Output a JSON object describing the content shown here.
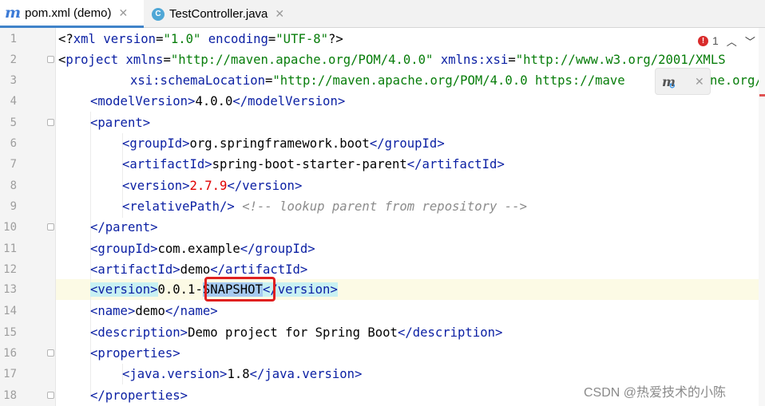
{
  "tabs": [
    {
      "label": "pom.xml (demo)",
      "icon": "maven-icon",
      "active": true
    },
    {
      "label": "TestController.java",
      "icon": "class-c-icon",
      "active": false
    }
  ],
  "inspections": {
    "error_count": "1"
  },
  "line_numbers": [
    "1",
    "2",
    "3",
    "4",
    "5",
    "6",
    "7",
    "8",
    "9",
    "10",
    "11",
    "12",
    "13",
    "14",
    "15",
    "16",
    "17",
    "18"
  ],
  "code": {
    "l1": {
      "a": "<?",
      "b": "xml",
      "c": " ",
      "d": "version",
      "e": "=",
      "f": "\"1.0\"",
      "g": " ",
      "h": "encoding",
      "i": "=",
      "j": "\"UTF-8\"",
      "k": "?>"
    },
    "l2": {
      "a": "<",
      "b": "project",
      "c": " ",
      "d": "xmlns",
      "e": "=",
      "f": "\"http://maven.apache.org/POM/4.0.0\"",
      "g": " ",
      "h": "xmlns:xsi",
      "i": "=",
      "j": "\"http://www.w3.org/2001/XMLS"
    },
    "l3": {
      "a": "xsi:schemaLocation",
      "b": "=",
      "c": "\"http://maven.apache.org/POM/4.0.0 https://mave",
      "d": "ne.org/x"
    },
    "l4": {
      "open": "<modelVersion>",
      "text": "4.0.0",
      "close": "</modelVersion>"
    },
    "l5": {
      "open": "<parent>"
    },
    "l6": {
      "open": "<groupId>",
      "text": "org.springframework.boot",
      "close": "</groupId>"
    },
    "l7": {
      "open": "<artifactId>",
      "text": "spring-boot-starter-parent",
      "close": "</artifactId>"
    },
    "l8": {
      "open": "<version>",
      "text": "2.7.9",
      "close": "</version>"
    },
    "l9": {
      "open": "<relativePath/>",
      "comment": " <!-- lookup parent from repository -->"
    },
    "l10": {
      "close": "</parent>"
    },
    "l11": {
      "open": "<groupId>",
      "text": "com.example",
      "close": "</groupId>"
    },
    "l12": {
      "open": "<artifactId>",
      "text": "demo",
      "close": "</artifactId>"
    },
    "l13": {
      "open": "<version>",
      "text_a": "0.0.1-",
      "text_b": "SNAPSHOT",
      "close": "</version>"
    },
    "l14": {
      "open": "<name>",
      "text": "demo",
      "close": "</name>"
    },
    "l15": {
      "open": "<description>",
      "text": "Demo project for Spring Boot",
      "close": "</description>"
    },
    "l16": {
      "open": "<properties>"
    },
    "l17": {
      "open": "<java.version>",
      "text": "1.8",
      "close": "</java.version>"
    },
    "l18": {
      "close": "</properties>"
    }
  },
  "watermark": "CSDN @热爱技术的小陈",
  "colors": {
    "tag": "#0a1fa3",
    "string": "#077d0a",
    "number": "#e00000",
    "comment": "#8c8c8c",
    "highlight_box": "#e02020"
  }
}
